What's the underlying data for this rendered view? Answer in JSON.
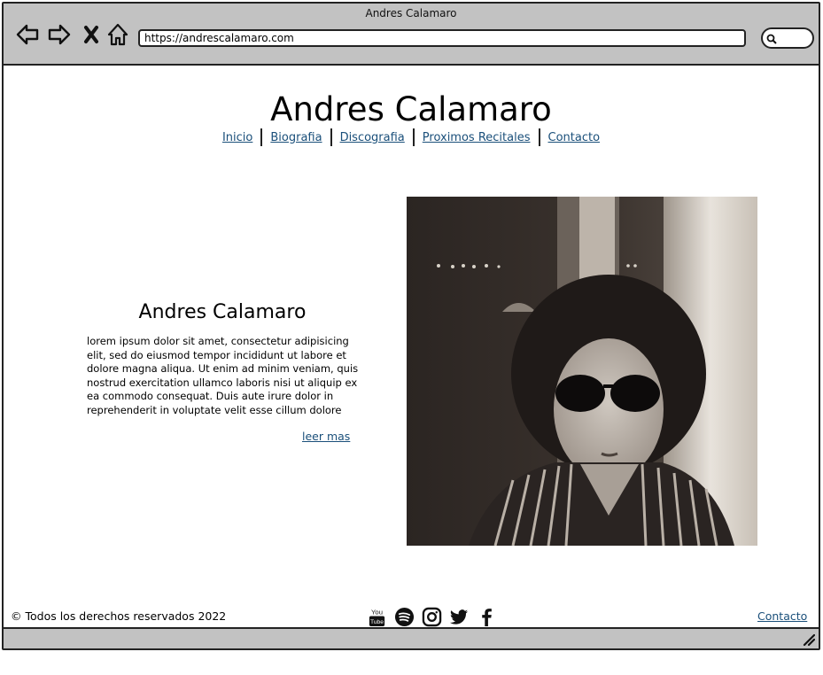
{
  "window": {
    "title": "Andres Calamaro"
  },
  "browser": {
    "url": "https://andrescalamaro.com",
    "icons": {
      "back": "back-arrow-icon",
      "forward": "forward-arrow-icon",
      "stop": "close-icon",
      "home": "home-icon",
      "search": "search-icon"
    }
  },
  "header": {
    "title": "Andres Calamaro",
    "nav": [
      "Inicio",
      "Biografia",
      "Discografia",
      "Proximos Recitales",
      "Contacto"
    ]
  },
  "main": {
    "title": "Andres Calamaro",
    "body": "lorem ipsum dolor sit amet, consectetur adipisicing elit, sed do eiusmod tempor incididunt ut labore et dolore magna aliqua. Ut enim ad minim veniam, quis nostrud exercitation ullamco laboris nisi ut aliquip ex ea commodo consequat. Duis aute irure dolor in reprehenderit in voluptate velit esse cillum dolore",
    "read_more": "leer mas"
  },
  "footer": {
    "copyright": "© Todos los derechos reservados 2022",
    "social_icons": [
      "youtube-icon",
      "spotify-icon",
      "instagram-icon",
      "twitter-icon",
      "facebook-icon"
    ],
    "contact_link": "Contacto"
  },
  "colors": {
    "link": "#1a4f7a",
    "chrome": "#c2c2c2",
    "border": "#222222"
  }
}
